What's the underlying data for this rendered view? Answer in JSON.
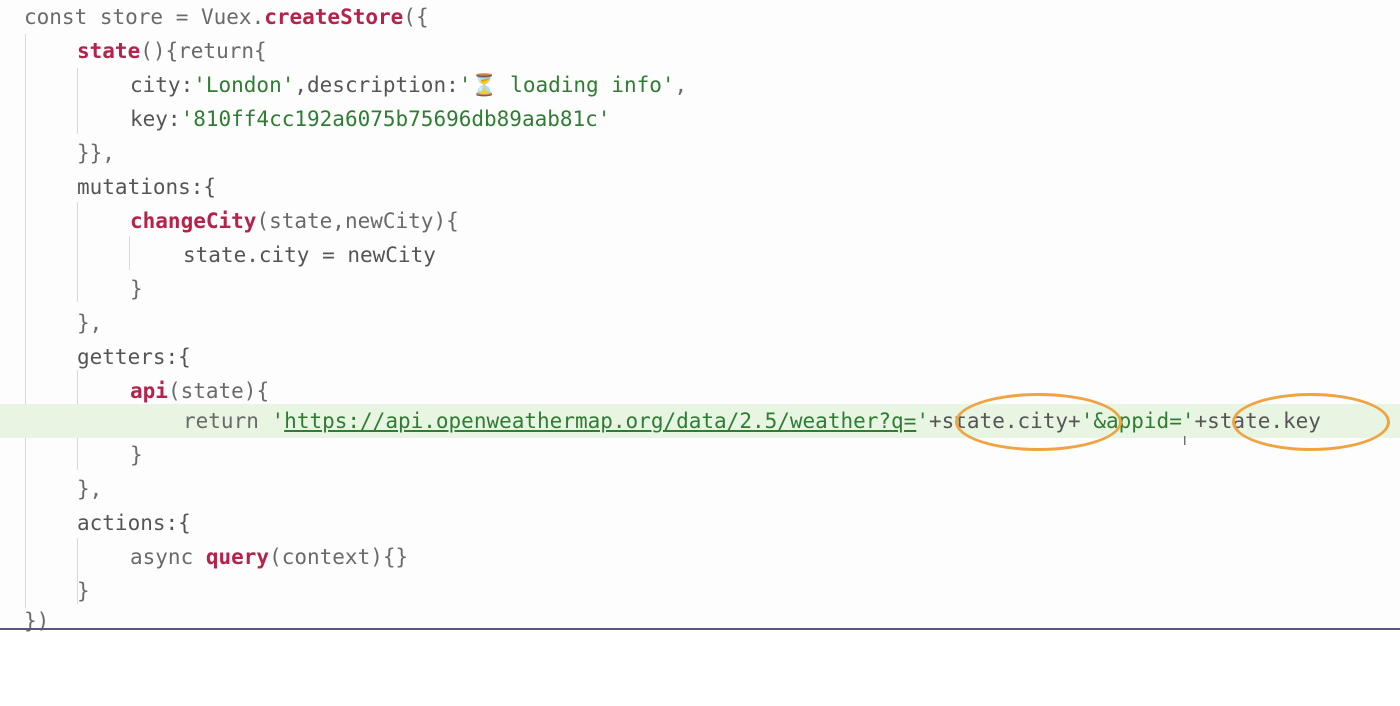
{
  "editor": {
    "lines": {
      "l1": {
        "a": "const store = Vuex.",
        "b": "createStore",
        "c": "({"
      },
      "l2": {
        "a": "state",
        "b": "(){return{"
      },
      "l3": {
        "a": "city:",
        "b": "'London'",
        "c": ",description:",
        "d": "'⏳ loading info'",
        "e": ","
      },
      "l4": {
        "a": "key:",
        "b": "'810ff4cc192a6075b75696db89aab81c'"
      },
      "l5": {
        "a": "}},"
      },
      "l6": {
        "a": "mutations:{"
      },
      "l7": {
        "a": "changeCity",
        "b": "(state,newCity){"
      },
      "l8": {
        "a": "state.city = newCity"
      },
      "l9": {
        "a": "}"
      },
      "l10": {
        "a": "},"
      },
      "l11": {
        "a": "getters:{"
      },
      "l12": {
        "a": "api",
        "b": "(state){"
      },
      "l13": {
        "a": "return ",
        "b": "'",
        "c": "https://api.openweathermap.org/data/2.5/weather?q=",
        "d": "'",
        "e": "+state.city+",
        "f": "'&appid='",
        "g": "+state.key"
      },
      "l14": {
        "a": "}"
      },
      "l15": {
        "a": "},"
      },
      "l16": {
        "a": "actions:{"
      },
      "l17": {
        "a": "async ",
        "b": "query",
        "c": "(context){}"
      },
      "l18": {
        "a": "}"
      },
      "l19": {
        "a": "})"
      }
    }
  },
  "colors": {
    "keyword_fn": "#b5234a",
    "string": "#2e7d32",
    "highlight_line": "#e8f5e2",
    "annotation_oval": "#f0a340"
  }
}
